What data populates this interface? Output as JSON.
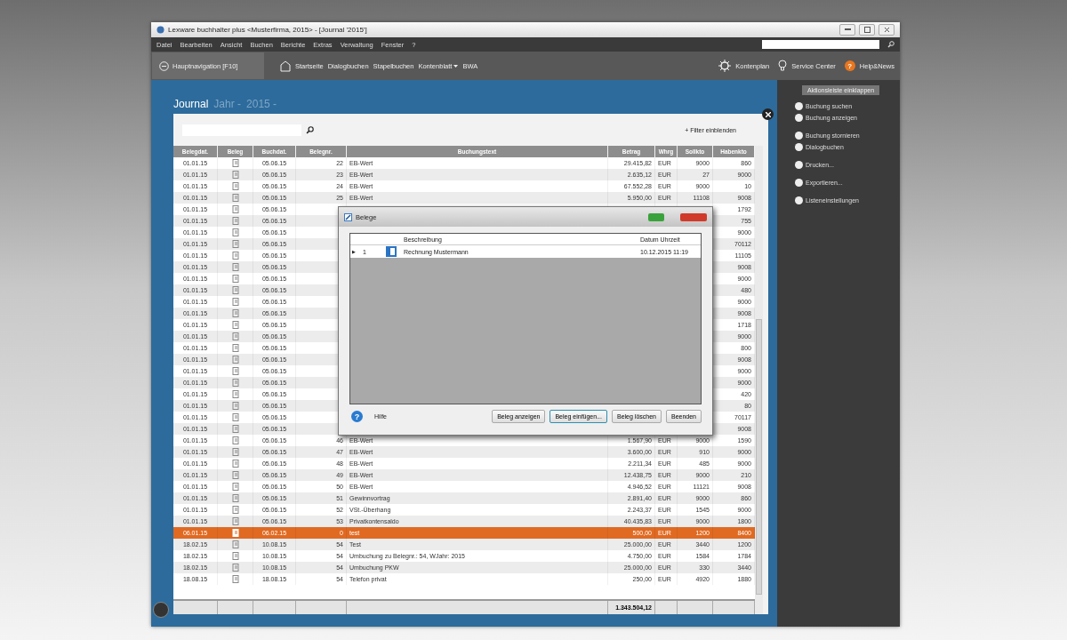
{
  "window": {
    "title": "Lexware buchhalter plus <Musterfirma, 2015> - [Journal '2015']"
  },
  "menu": [
    "Datei",
    "Bearbeiten",
    "Ansicht",
    "Buchen",
    "Berichte",
    "Extras",
    "Verwaltung",
    "Fenster",
    "?"
  ],
  "navigation": {
    "main_button": "Hauptnavigation [F10]",
    "links": [
      {
        "label": "Startseite",
        "dropdown": false
      },
      {
        "label": "Dialogbuchen",
        "dropdown": false
      },
      {
        "label": "Stapelbuchen",
        "dropdown": false
      },
      {
        "label": "Kontenblatt",
        "dropdown": true
      },
      {
        "label": "BWA",
        "dropdown": false
      }
    ],
    "right": [
      {
        "kind": "gear",
        "label": "Kontenplan"
      },
      {
        "kind": "bulb",
        "label": "Service Center"
      },
      {
        "kind": "badge",
        "badge": "?",
        "label": "Help&News"
      }
    ]
  },
  "journal": {
    "title": "Journal",
    "year_label": "Jahr -",
    "year": "2015 -",
    "filter_link": "+ Filter einblenden",
    "columns": [
      "Belegdat.",
      "Beleg",
      "Buchdat.",
      "Belegnr.",
      "Buchungstext",
      "Betrag",
      "Whrg",
      "Sollkto",
      "Habenkto"
    ],
    "rows": [
      {
        "belegdat": "01.01.15",
        "buchdat": "05.06.15",
        "belegnr": "22",
        "text": "EB-Wert",
        "betrag": "29.415,82",
        "whrg": "EUR",
        "sollkto": "9000",
        "habenkto": "860",
        "selected": false
      },
      {
        "belegdat": "01.01.15",
        "buchdat": "05.06.15",
        "belegnr": "23",
        "text": "EB-Wert",
        "betrag": "2.635,12",
        "whrg": "EUR",
        "sollkto": "27",
        "habenkto": "9000",
        "selected": false
      },
      {
        "belegdat": "01.01.15",
        "buchdat": "05.06.15",
        "belegnr": "24",
        "text": "EB-Wert",
        "betrag": "67.552,28",
        "whrg": "EUR",
        "sollkto": "9000",
        "habenkto": "10",
        "selected": false
      },
      {
        "belegdat": "01.01.15",
        "buchdat": "05.06.15",
        "belegnr": "25",
        "text": "EB-Wert",
        "betrag": "5.950,00",
        "whrg": "EUR",
        "sollkto": "11108",
        "habenkto": "9008",
        "selected": false
      },
      {
        "belegdat": "01.01.15",
        "buchdat": "05.06.15",
        "habenkto": "1792",
        "selected": false
      },
      {
        "belegdat": "01.01.15",
        "buchdat": "05.06.15",
        "habenkto": "755",
        "selected": false
      },
      {
        "belegdat": "01.01.15",
        "buchdat": "05.06.15",
        "habenkto": "9000",
        "selected": false
      },
      {
        "belegdat": "01.01.15",
        "buchdat": "05.06.15",
        "habenkto": "70112",
        "selected": false
      },
      {
        "belegdat": "01.01.15",
        "buchdat": "05.06.15",
        "habenkto": "11105",
        "selected": false
      },
      {
        "belegdat": "01.01.15",
        "buchdat": "05.06.15",
        "habenkto": "9008",
        "selected": false
      },
      {
        "belegdat": "01.01.15",
        "buchdat": "05.06.15",
        "habenkto": "9000",
        "selected": false
      },
      {
        "belegdat": "01.01.15",
        "buchdat": "05.06.15",
        "habenkto": "480",
        "selected": false
      },
      {
        "belegdat": "01.01.15",
        "buchdat": "05.06.15",
        "habenkto": "9000",
        "selected": false
      },
      {
        "belegdat": "01.01.15",
        "buchdat": "05.06.15",
        "habenkto": "9008",
        "selected": false
      },
      {
        "belegdat": "01.01.15",
        "buchdat": "05.06.15",
        "habenkto": "1718",
        "selected": false
      },
      {
        "belegdat": "01.01.15",
        "buchdat": "05.06.15",
        "habenkto": "9000",
        "selected": false
      },
      {
        "belegdat": "01.01.15",
        "buchdat": "05.06.15",
        "habenkto": "800",
        "selected": false
      },
      {
        "belegdat": "01.01.15",
        "buchdat": "05.06.15",
        "habenkto": "9008",
        "selected": false
      },
      {
        "belegdat": "01.01.15",
        "buchdat": "05.06.15",
        "habenkto": "9000",
        "selected": false
      },
      {
        "belegdat": "01.01.15",
        "buchdat": "05.06.15",
        "habenkto": "9000",
        "selected": false
      },
      {
        "belegdat": "01.01.15",
        "buchdat": "05.06.15",
        "habenkto": "420",
        "selected": false
      },
      {
        "belegdat": "01.01.15",
        "buchdat": "05.06.15",
        "habenkto": "80",
        "selected": false
      },
      {
        "belegdat": "01.01.15",
        "buchdat": "05.06.15",
        "habenkto": "70117",
        "selected": false
      },
      {
        "belegdat": "01.01.15",
        "buchdat": "05.06.15",
        "habenkto": "9008",
        "selected": false
      },
      {
        "belegdat": "01.01.15",
        "buchdat": "05.06.15",
        "belegnr": "46",
        "text": "EB-Wert",
        "betrag": "1.567,90",
        "whrg": "EUR",
        "sollkto": "9000",
        "habenkto": "1590",
        "selected": false
      },
      {
        "belegdat": "01.01.15",
        "buchdat": "05.06.15",
        "belegnr": "47",
        "text": "EB-Wert",
        "betrag": "3.600,00",
        "whrg": "EUR",
        "sollkto": "910",
        "habenkto": "9000",
        "selected": false
      },
      {
        "belegdat": "01.01.15",
        "buchdat": "05.06.15",
        "belegnr": "48",
        "text": "EB-Wert",
        "betrag": "2.211,34",
        "whrg": "EUR",
        "sollkto": "485",
        "habenkto": "9000",
        "selected": false
      },
      {
        "belegdat": "01.01.15",
        "buchdat": "05.06.15",
        "belegnr": "49",
        "text": "EB-Wert",
        "betrag": "12.438,75",
        "whrg": "EUR",
        "sollkto": "9000",
        "habenkto": "210",
        "selected": false
      },
      {
        "belegdat": "01.01.15",
        "buchdat": "05.06.15",
        "belegnr": "50",
        "text": "EB-Wert",
        "betrag": "4.946,52",
        "whrg": "EUR",
        "sollkto": "11121",
        "habenkto": "9008",
        "selected": false
      },
      {
        "belegdat": "01.01.15",
        "buchdat": "05.06.15",
        "belegnr": "51",
        "text": "Gewinnvortrag",
        "betrag": "2.891,40",
        "whrg": "EUR",
        "sollkto": "9000",
        "habenkto": "860",
        "selected": false
      },
      {
        "belegdat": "01.01.15",
        "buchdat": "05.06.15",
        "belegnr": "52",
        "text": "VSt.-Überhang",
        "betrag": "2.243,37",
        "whrg": "EUR",
        "sollkto": "1545",
        "habenkto": "9000",
        "selected": false
      },
      {
        "belegdat": "01.01.15",
        "buchdat": "05.06.15",
        "belegnr": "53",
        "text": "Privatkontensaldo",
        "betrag": "40.435,83",
        "whrg": "EUR",
        "sollkto": "9000",
        "habenkto": "1800",
        "selected": false
      },
      {
        "belegdat": "06.01.15",
        "buchdat": "06.02.15",
        "belegnr": "0",
        "text": "test",
        "betrag": "500,00",
        "whrg": "EUR",
        "sollkto": "1200",
        "habenkto": "8400",
        "selected": true
      },
      {
        "belegdat": "18.02.15",
        "buchdat": "10.08.15",
        "belegnr": "54",
        "text": "Test",
        "betrag": "25.000,00",
        "whrg": "EUR",
        "sollkto": "3440",
        "habenkto": "1200",
        "selected": false
      },
      {
        "belegdat": "18.02.15",
        "buchdat": "10.08.15",
        "belegnr": "54",
        "text": "Umbuchung zu Belegnr.: 54, WJahr: 2015",
        "betrag": "4.750,00",
        "whrg": "EUR",
        "sollkto": "1584",
        "habenkto": "1784",
        "selected": false
      },
      {
        "belegdat": "18.02.15",
        "buchdat": "10.08.15",
        "belegnr": "54",
        "text": "Umbuchung PKW",
        "betrag": "25.000,00",
        "whrg": "EUR",
        "sollkto": "330",
        "habenkto": "3440",
        "selected": false
      },
      {
        "belegdat": "18.08.15",
        "buchdat": "18.08.15",
        "belegnr": "54",
        "text": "Telefon privat",
        "betrag": "250,00",
        "whrg": "EUR",
        "sollkto": "4920",
        "habenkto": "1880",
        "selected": false
      }
    ],
    "total": "1.343.504,12"
  },
  "sidebar": {
    "collapse_button": "Aktionsleiste einklappen",
    "groups": [
      [
        "Buchung suchen",
        "Buchung anzeigen"
      ],
      [
        "Buchung stornieren",
        "Dialogbuchen"
      ],
      [
        "Drucken..."
      ],
      [
        "Exportieren..."
      ],
      [
        "Listeneinstellungen"
      ]
    ]
  },
  "dialog": {
    "title": "Belege",
    "columns": [
      "Beschreibung",
      "Datum Uhrzeit"
    ],
    "rows": [
      {
        "marker": "▶",
        "number": "1",
        "description": "Rechnung Mustermann",
        "datetime": "10.12.2015 11:19"
      }
    ],
    "help_icon": "?",
    "help": "Hilfe",
    "buttons": [
      {
        "label": "Beleg anzeigen",
        "focused": false
      },
      {
        "label": "Beleg einfügen...",
        "focused": true
      },
      {
        "label": "Beleg löschen",
        "focused": false
      },
      {
        "label": "Beenden",
        "focused": false
      }
    ]
  }
}
